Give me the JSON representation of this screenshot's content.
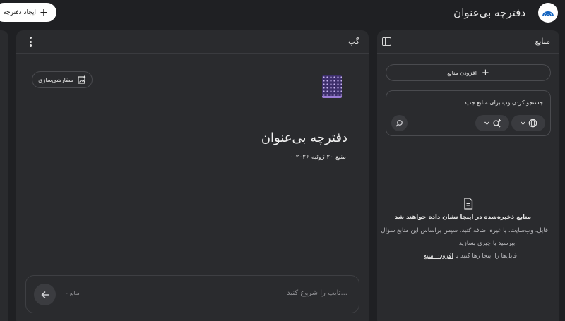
{
  "header": {
    "create_label": "ایجاد دفترچه",
    "notebook_title": "دفترچه بی‌عنوان"
  },
  "chat": {
    "title": "گپ",
    "customize_label": "سفارشی‌سازی",
    "notebook_heading": "دفترچه بی‌عنوان",
    "meta": "۰ منبع ۲۰ ژوئیه ۲۰۲۶",
    "input_placeholder": "تایپ را شروع کنید...",
    "source_count": "۰ منابع"
  },
  "sources": {
    "title": "منابع",
    "add_label": "افزودن منابع",
    "search_placeholder": "جستجو کردن وب برای منابع جدید",
    "empty_title": "منابع ذخیره‌شده در اینجا نشان داده خواهند شد",
    "empty_line1": "فایل، وب‌سایت، یا غیره اضافه کنید. سپس براساس این منابع سؤال",
    "empty_line2": "بپرسید یا چیزی بسازید.",
    "empty_line3_prefix": "فایل‌ها را اینجا رها کنید یا",
    "empty_line3_link": "افزودن منبع"
  },
  "icons": {
    "logo": "notebooklm-logo-icon",
    "accent": "#2a2b2e",
    "background": "#1f2023"
  }
}
